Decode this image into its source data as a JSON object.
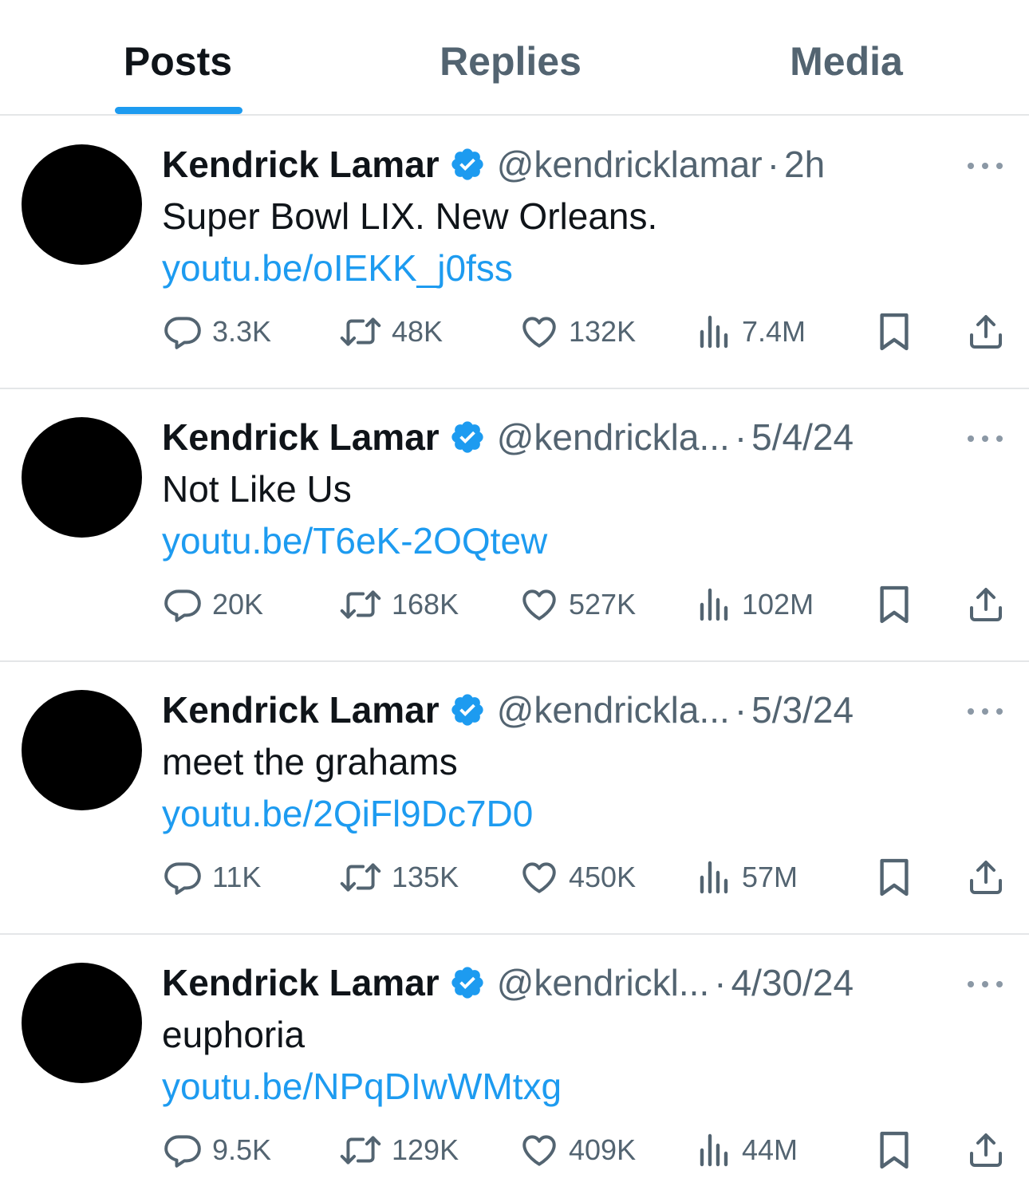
{
  "tabs": [
    {
      "label": "Posts",
      "active": true
    },
    {
      "label": "Replies",
      "active": false
    },
    {
      "label": "Media",
      "active": false
    }
  ],
  "colors": {
    "accent": "#1d9bf0",
    "text": "#0f1419",
    "secondary": "#536471",
    "divider": "#e4e6e8"
  },
  "posts": [
    {
      "name": "Kendrick Lamar",
      "handle": "@kendricklamar",
      "dot": "·",
      "time": "2h",
      "text": "Super Bowl LIX. New Orleans.",
      "link": "youtu.be/oIEKK_j0fss",
      "replies": "3.3K",
      "reposts": "48K",
      "likes": "132K",
      "views": "7.4M"
    },
    {
      "name": "Kendrick Lamar",
      "handle": "@kendrickla...",
      "dot": "·",
      "time": "5/4/24",
      "text": "Not Like Us",
      "link": "youtu.be/T6eK-2OQtew",
      "replies": "20K",
      "reposts": "168K",
      "likes": "527K",
      "views": "102M"
    },
    {
      "name": "Kendrick Lamar",
      "handle": "@kendrickla...",
      "dot": "·",
      "time": "5/3/24",
      "text": "meet the grahams",
      "link": "youtu.be/2QiFl9Dc7D0",
      "replies": "11K",
      "reposts": "135K",
      "likes": "450K",
      "views": "57M"
    },
    {
      "name": "Kendrick Lamar",
      "handle": "@kendrickl...",
      "dot": "·",
      "time": "4/30/24",
      "text": "euphoria",
      "link": "youtu.be/NPqDIwWMtxg",
      "replies": "9.5K",
      "reposts": "129K",
      "likes": "409K",
      "views": "44M"
    }
  ]
}
